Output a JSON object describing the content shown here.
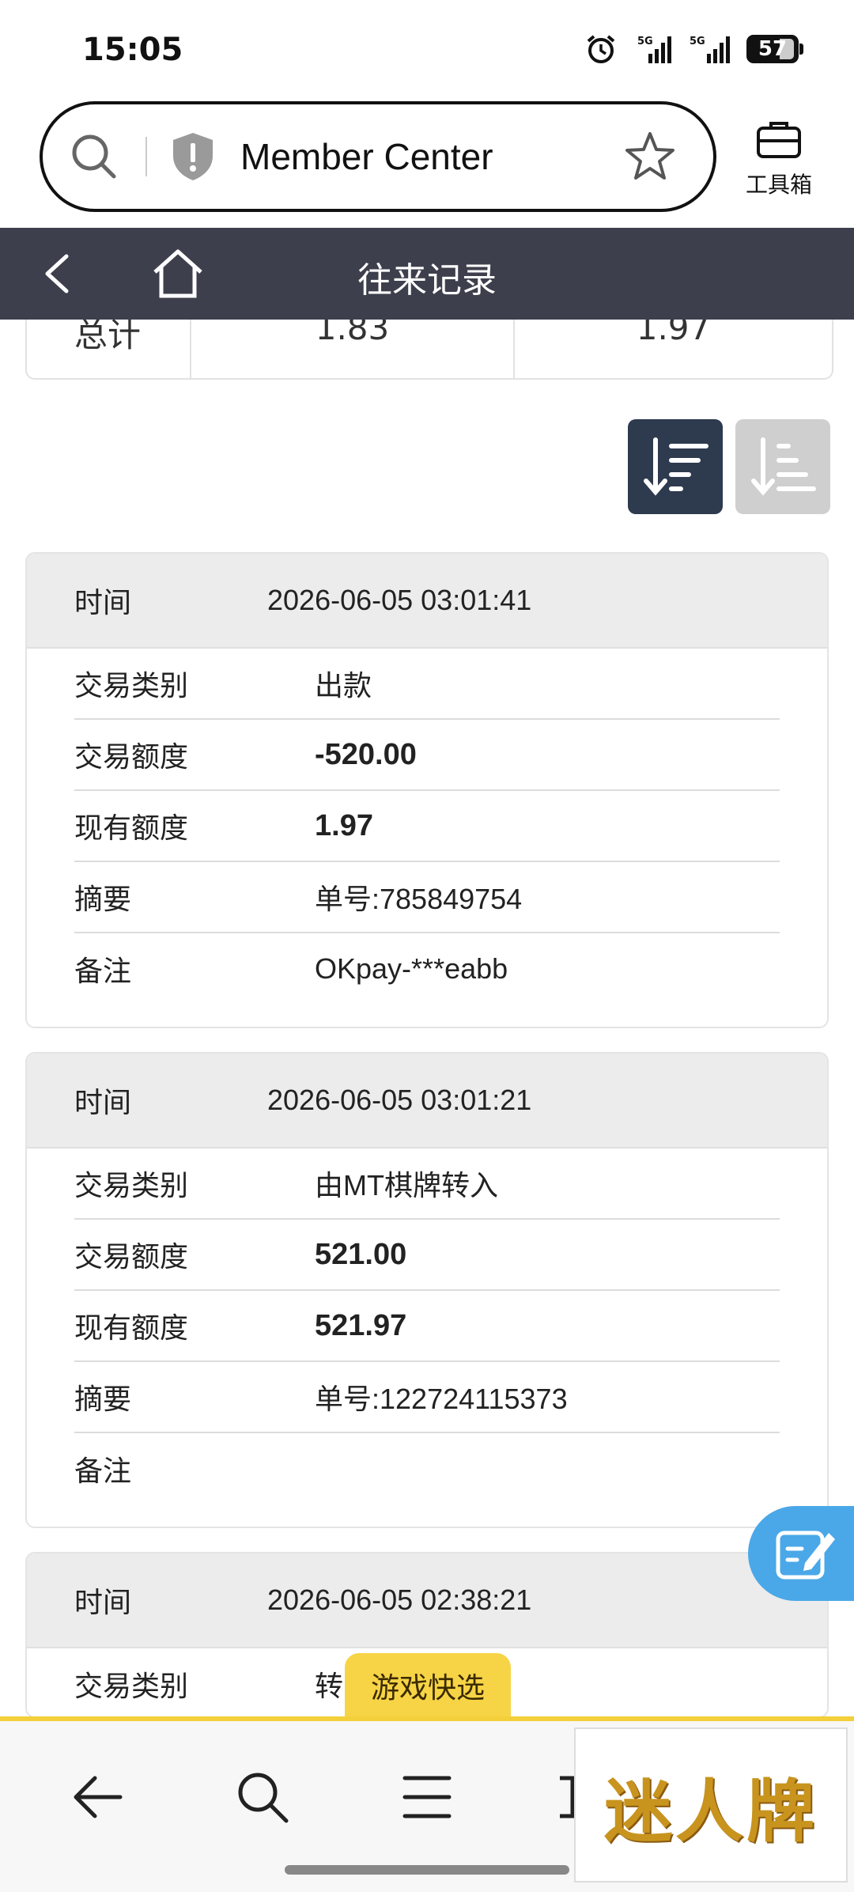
{
  "status_bar": {
    "time": "15:05",
    "battery": "57",
    "signal1": "5G",
    "signal2": "5G"
  },
  "browser": {
    "url_title": "Member Center",
    "toolbox_label": "工具箱"
  },
  "header": {
    "title": "往来记录"
  },
  "totals": {
    "label": "总计",
    "col1": "1.83",
    "col2": "1.97"
  },
  "records": [
    {
      "time_label": "时间",
      "time": "2026-06-05 03:01:41",
      "type_label": "交易类别",
      "type": "出款",
      "amount_label": "交易额度",
      "amount": "-520.00",
      "balance_label": "现有额度",
      "balance": "1.97",
      "summary_label": "摘要",
      "summary": "单号:785849754",
      "note_label": "备注",
      "note": "OKpay-***eabb"
    },
    {
      "time_label": "时间",
      "time": "2026-06-05 03:01:21",
      "type_label": "交易类别",
      "type": "由MT棋牌转入",
      "amount_label": "交易额度",
      "amount": "521.00",
      "balance_label": "现有额度",
      "balance": "521.97",
      "summary_label": "摘要",
      "summary": "单号:122724115373",
      "note_label": "备注",
      "note": ""
    },
    {
      "time_label": "时间",
      "time": "2026-06-05 02:38:21",
      "type_label": "交易类别",
      "type": "转"
    }
  ],
  "quick_select_label": "游戏快选",
  "logo_text": "迷人牌",
  "colors": {
    "title_bar": "#3d3f4c",
    "sort_active": "#2e3a4e",
    "sort_inactive": "#cfcfcf",
    "float_button": "#4aa8e8",
    "quick_tab": "#f7d445"
  }
}
